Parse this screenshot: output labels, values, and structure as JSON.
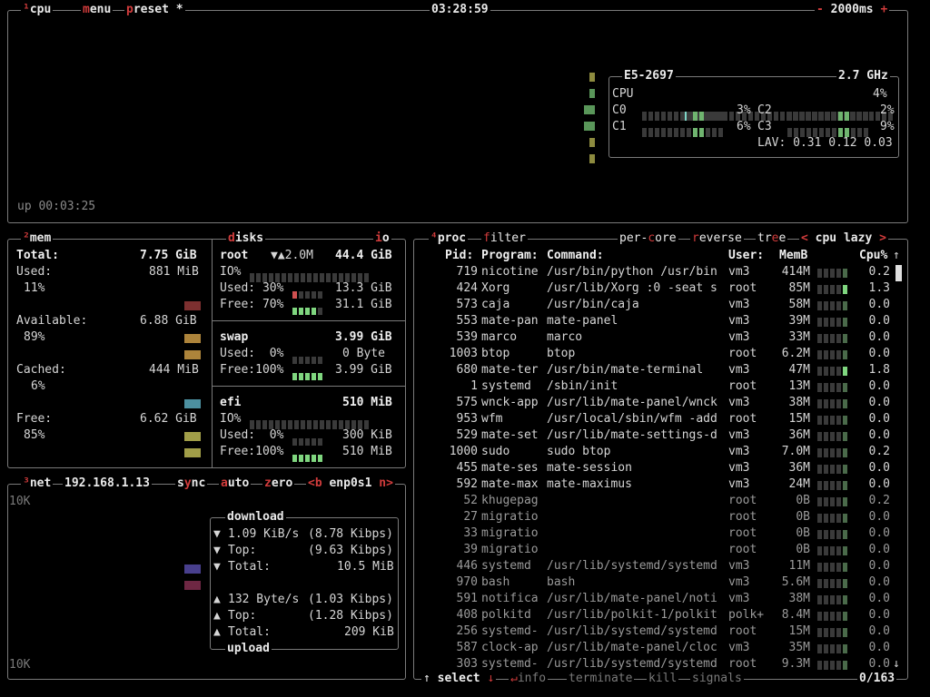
{
  "cpu_box": {
    "label_num": "¹",
    "label": "cpu",
    "menu": "menu",
    "preset": "preset",
    "star": "*",
    "clock": "03:28:59",
    "minus": "-",
    "interval": "2000ms",
    "plus": "+",
    "uptime": "up 00:03:25",
    "model": "E5-2697",
    "freq": "2.7 GHz",
    "cpu_label": "CPU",
    "cpu_pct": "4%",
    "cores": [
      {
        "name": "C0",
        "pct": "3%"
      },
      {
        "name": "C2",
        "pct": "2%"
      },
      {
        "name": "C1",
        "pct": "6%"
      },
      {
        "name": "C3",
        "pct": "9%"
      }
    ],
    "lav": "LAV: 0.31 0.12 0.03"
  },
  "mem_box": {
    "label_num": "²",
    "label": "mem",
    "total_label": "Total:",
    "total_value": "7.75 GiB",
    "items": [
      {
        "label": "Used:",
        "value": "881 MiB",
        "pct": "11%"
      },
      {
        "label": "Available:",
        "value": "6.88 GiB",
        "pct": "89%"
      },
      {
        "label": "Cached:",
        "value": "444 MiB",
        "pct": "6%"
      },
      {
        "label": "Free:",
        "value": "6.62 GiB",
        "pct": "85%"
      }
    ]
  },
  "disks_box": {
    "label": "disks",
    "io_label": "io",
    "disks": [
      {
        "name": "root",
        "extra": "▼▲2.0M",
        "size": "44.4 GiB",
        "io_label": "IO%",
        "used_label": "Used: 30%",
        "used_value": "13.3 GiB",
        "free_label": "Free: 70%",
        "free_value": "31.1 GiB"
      },
      {
        "name": "swap",
        "extra": "",
        "size": "3.99 GiB",
        "used_label": "Used:  0%",
        "used_value": "0 Byte",
        "free_label": "Free:100%",
        "free_value": "3.99 GiB"
      },
      {
        "name": "efi",
        "extra": "",
        "size": "510 MiB",
        "io_label": "IO%",
        "used_label": "Used:  0%",
        "used_value": "300 KiB",
        "free_label": "Free:100%",
        "free_value": "510 MiB"
      }
    ]
  },
  "net_box": {
    "label_num": "³",
    "label": "net",
    "ip": "192.168.1.13",
    "sync": "sync",
    "auto": "auto",
    "zero": "zero",
    "prev": "<b",
    "iface": "enp0s1",
    "next": "n>",
    "scale_top": "10K",
    "scale_bottom": "10K",
    "download_title": "download",
    "upload_title": "upload",
    "download": [
      {
        "arrow": "▼",
        "label": "1.09 KiB/s",
        "value": "(8.78 Kibps)"
      },
      {
        "arrow": "▼",
        "label": "Top:",
        "value": "(9.63 Kibps)"
      },
      {
        "arrow": "▼",
        "label": "Total:",
        "value": "10.5 MiB"
      }
    ],
    "upload": [
      {
        "arrow": "▲",
        "label": "132 Byte/s",
        "value": "(1.03 Kibps)"
      },
      {
        "arrow": "▲",
        "label": "Top:",
        "value": "(1.28 Kibps)"
      },
      {
        "arrow": "▲",
        "label": "Total:",
        "value": "209 KiB"
      }
    ]
  },
  "proc_box": {
    "label_num": "⁴",
    "label": "proc",
    "filter": "filter",
    "per_core": "per-core",
    "reverse": "reverse",
    "tree": "tree",
    "sort_prev": "<",
    "sort": "cpu lazy",
    "sort_next": ">",
    "columns": [
      "Pid:",
      "Program:",
      "Command:",
      "User:",
      "MemB",
      "Cpu%"
    ],
    "rows": [
      [
        "719",
        "nicotine",
        "/usr/bin/python /usr/bin",
        "vm3",
        "414M",
        "0.2"
      ],
      [
        "424",
        "Xorg",
        "/usr/lib/Xorg :0 -seat s",
        "root",
        "85M",
        "1.3"
      ],
      [
        "573",
        "caja",
        "/usr/bin/caja",
        "vm3",
        "58M",
        "0.0"
      ],
      [
        "553",
        "mate-pan",
        "mate-panel",
        "vm3",
        "39M",
        "0.0"
      ],
      [
        "539",
        "marco",
        "marco",
        "vm3",
        "33M",
        "0.0"
      ],
      [
        "1003",
        "btop",
        "btop",
        "root",
        "6.2M",
        "0.0"
      ],
      [
        "680",
        "mate-ter",
        "/usr/bin/mate-terminal",
        "vm3",
        "47M",
        "1.8"
      ],
      [
        "1",
        "systemd",
        "/sbin/init",
        "root",
        "13M",
        "0.0"
      ],
      [
        "575",
        "wnck-app",
        "/usr/lib/mate-panel/wnck",
        "vm3",
        "38M",
        "0.0"
      ],
      [
        "953",
        "wfm",
        "/usr/local/sbin/wfm -add",
        "root",
        "15M",
        "0.0"
      ],
      [
        "529",
        "mate-set",
        "/usr/lib/mate-settings-d",
        "vm3",
        "36M",
        "0.0"
      ],
      [
        "1000",
        "sudo",
        "sudo btop",
        "vm3",
        "7.0M",
        "0.2"
      ],
      [
        "455",
        "mate-ses",
        "mate-session",
        "vm3",
        "36M",
        "0.0"
      ],
      [
        "592",
        "mate-max",
        "mate-maximus",
        "vm3",
        "24M",
        "0.0"
      ],
      [
        "52",
        "khugepag",
        "",
        "root",
        "0B",
        "0.2"
      ],
      [
        "27",
        "migratio",
        "",
        "root",
        "0B",
        "0.0"
      ],
      [
        "33",
        "migratio",
        "",
        "root",
        "0B",
        "0.0"
      ],
      [
        "39",
        "migratio",
        "",
        "root",
        "0B",
        "0.0"
      ],
      [
        "446",
        "systemd",
        "/usr/lib/systemd/systemd",
        "vm3",
        "11M",
        "0.0"
      ],
      [
        "970",
        "bash",
        "bash",
        "vm3",
        "5.6M",
        "0.0"
      ],
      [
        "591",
        "notifica",
        "/usr/lib/mate-panel/noti",
        "vm3",
        "38M",
        "0.0"
      ],
      [
        "408",
        "polkitd",
        "/usr/lib/polkit-1/polkit",
        "polk+",
        "8.4M",
        "0.0"
      ],
      [
        "256",
        "systemd-",
        "/usr/lib/systemd/systemd",
        "root",
        "15M",
        "0.0"
      ],
      [
        "587",
        "clock-ap",
        "/usr/lib/mate-panel/cloc",
        "vm3",
        "35M",
        "0.0"
      ],
      [
        "303",
        "systemd-",
        "/usr/lib/systemd/systemd",
        "root",
        "9.3M",
        "0.0"
      ]
    ],
    "footer": {
      "up": "↑",
      "select": "select",
      "down": "↓",
      "info": "info",
      "terminate": "terminate",
      "kill": "kill",
      "signals": "signals",
      "count": "0/163"
    },
    "scroll_up": "↑",
    "scroll_down": "↓"
  }
}
